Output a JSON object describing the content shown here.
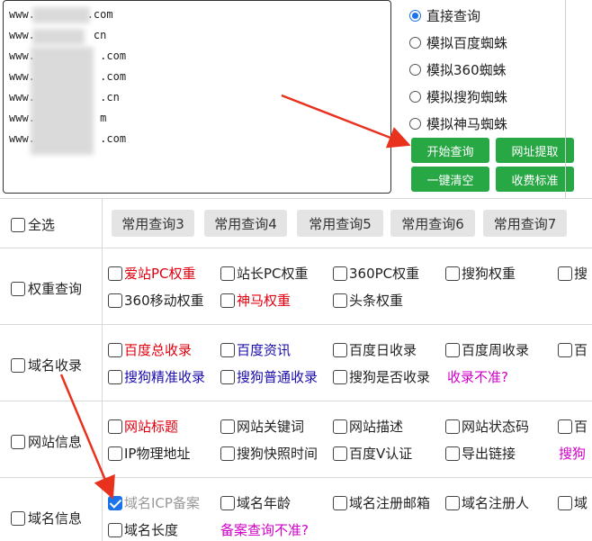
{
  "url_box": {
    "lines": [
      "www.        .com",
      "www.         cn",
      "www.          .com",
      "www.          .com",
      "www.          .cn",
      "www.          m",
      "www.          .com"
    ]
  },
  "query_modes": [
    {
      "label": "直接查询",
      "selected": true
    },
    {
      "label": "模拟百度蜘蛛",
      "selected": false
    },
    {
      "label": "模拟360蜘蛛",
      "selected": false
    },
    {
      "label": "模拟搜狗蜘蛛",
      "selected": false
    },
    {
      "label": "模拟神马蜘蛛",
      "selected": false
    }
  ],
  "buttons": {
    "start": "开始查询",
    "extract": "网址提取",
    "clear": "一键清空",
    "fees": "收费标准"
  },
  "select_all": "全选",
  "common_queries": [
    "常用查询3",
    "常用查询4",
    "常用查询5",
    "常用查询6",
    "常用查询7"
  ],
  "categories": {
    "weight": "权重查询",
    "index": "域名收录",
    "site_info": "网站信息",
    "domain_info": "域名信息"
  },
  "weight_options": [
    "爱站PC权重",
    "站长PC权重",
    "360PC权重",
    "搜狗权重",
    "搜",
    "360移动权重",
    "神马权重",
    "头条权重"
  ],
  "index_options": [
    "百度总收录",
    "百度资讯",
    "百度日收录",
    "百度周收录",
    "百",
    "搜狗精准收录",
    "搜狗普通收录",
    "搜狗是否收录"
  ],
  "index_note": "收录不准?",
  "site_options": [
    "网站标题",
    "网站关键词",
    "网站描述",
    "网站状态码",
    "百",
    "IP物理地址",
    "搜狗快照时间",
    "百度V认证",
    "导出链接"
  ],
  "site_partial": "搜狗",
  "domain_options": [
    "域名ICP备案",
    "域名年龄",
    "域名注册邮箱",
    "域名注册人",
    "域",
    "域名长度"
  ],
  "domain_note": "备案查询不准?",
  "colors": {
    "green": "#28a745",
    "red": "#e0000f",
    "blue": "#1a0dab",
    "magenta": "#d100c8",
    "arrow": "#e8321e"
  }
}
